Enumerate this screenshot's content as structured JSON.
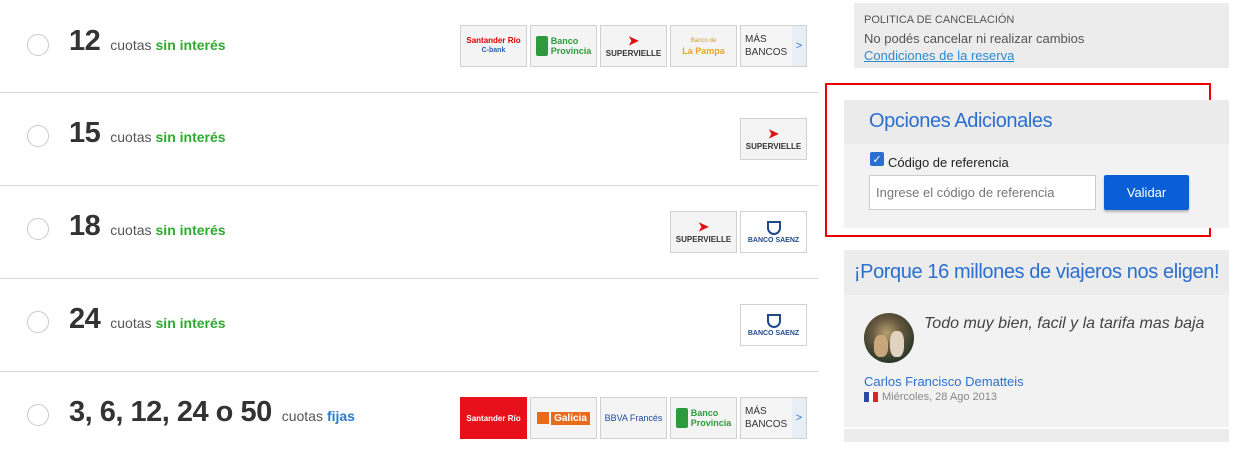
{
  "plans": [
    {
      "number": "12",
      "cuotas": "cuotas",
      "type": "sin interés",
      "type_color": "#2eaa2e"
    },
    {
      "number": "15",
      "cuotas": "cuotas",
      "type": "sin interés",
      "type_color": "#2eaa2e"
    },
    {
      "number": "18",
      "cuotas": "cuotas",
      "type": "sin interés",
      "type_color": "#2eaa2e"
    },
    {
      "number": "24",
      "cuotas": "cuotas",
      "type": "sin interés",
      "type_color": "#2eaa2e"
    },
    {
      "number": "3, 6, 12, 24 o 50",
      "cuotas": "cuotas",
      "type": "fijas",
      "type_color": "#2a7ad0"
    }
  ],
  "banks": {
    "santander": "Santander Río",
    "santander_sub": "C-bank",
    "provincia_1": "Banco",
    "provincia_2": "Provincia",
    "supervielle": "SUPERVIELLE",
    "lapampa_1": "Banco de",
    "lapampa_2": "La Pampa",
    "saenz": "BANCO SAENZ",
    "galicia": "Galicia",
    "bbva": "BBVA Francés",
    "more_1": "MÁS",
    "more_2": "BANCOS",
    "more_arrow": ">"
  },
  "politica": {
    "title": "POLITICA DE CANCELACIÓN",
    "text": "No podés cancelar ni realizar cambios",
    "link": "Condiciones de la reserva"
  },
  "opciones": {
    "title": "Opciones Adicionales",
    "checkbox_label": "Código de referencia",
    "checked": true,
    "input_placeholder": "Ingrese el código de referencia",
    "button": "Validar"
  },
  "porque": {
    "title": "¡Porque 16 millones de viajeros nos eligen!"
  },
  "review": {
    "quote": "Todo muy bien, facil y la tarifa mas baja",
    "author": "Carlos Francisco Dematteis",
    "date": "Miércoles, 28 Ago 2013"
  },
  "colors": {
    "accent_blue": "#2a6fd0",
    "button_blue": "#0a5fd6",
    "green": "#2eaa2e",
    "highlight_red": "#e00000"
  }
}
